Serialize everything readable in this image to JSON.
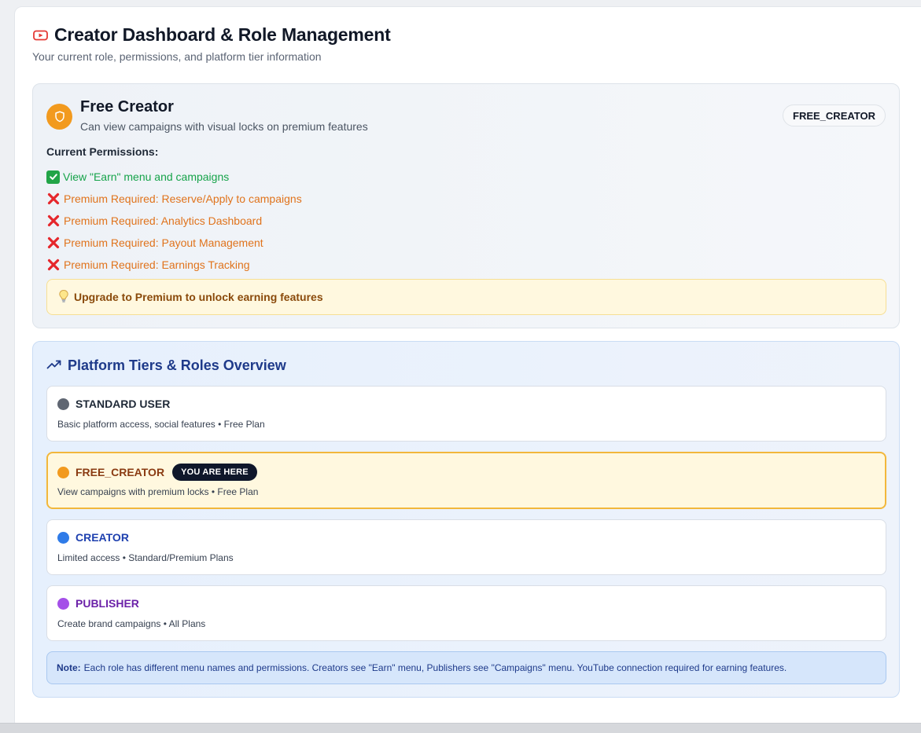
{
  "header": {
    "title": "Creator Dashboard & Role Management",
    "subtitle": "Your current role, permissions, and platform tier information",
    "icon": "youtube-icon"
  },
  "current_role": {
    "name": "Free Creator",
    "description": "Can view campaigns with visual locks on premium features",
    "badge": "FREE_CREATOR",
    "icon": "shield-icon",
    "permissions_heading": "Current Permissions:",
    "permissions": [
      {
        "allowed": true,
        "text": "View \"Earn\" menu and campaigns"
      },
      {
        "allowed": false,
        "text": "Premium Required: Reserve/Apply to campaigns"
      },
      {
        "allowed": false,
        "text": "Premium Required: Analytics Dashboard"
      },
      {
        "allowed": false,
        "text": "Premium Required: Payout Management"
      },
      {
        "allowed": false,
        "text": "Premium Required: Earnings Tracking"
      }
    ],
    "upgrade_tip": "Upgrade to Premium to unlock earning features"
  },
  "tiers": {
    "title": "Platform Tiers & Roles Overview",
    "icon": "trending-up-icon",
    "items": [
      {
        "name": "STANDARD USER",
        "description": "Basic platform access, social features • Free Plan",
        "color": "#5f6672",
        "name_color": "#1f2937",
        "current": false
      },
      {
        "name": "FREE_CREATOR",
        "description": "View campaigns with premium locks • Free Plan",
        "color": "#f29a1e",
        "name_color": "#8a3b12",
        "current": true,
        "pill": "YOU ARE HERE"
      },
      {
        "name": "CREATOR",
        "description": "Limited access • Standard/Premium Plans",
        "color": "#2f7be8",
        "name_color": "#1e40af",
        "current": false
      },
      {
        "name": "PUBLISHER",
        "description": "Create brand campaigns • All Plans",
        "color": "#a450e8",
        "name_color": "#6b21a8",
        "current": false
      }
    ],
    "note_label": "Note:",
    "note_text": "Each role has different menu names and permissions. Creators see \"Earn\" menu, Publishers see \"Campaigns\" menu. YouTube connection required for earning features."
  }
}
